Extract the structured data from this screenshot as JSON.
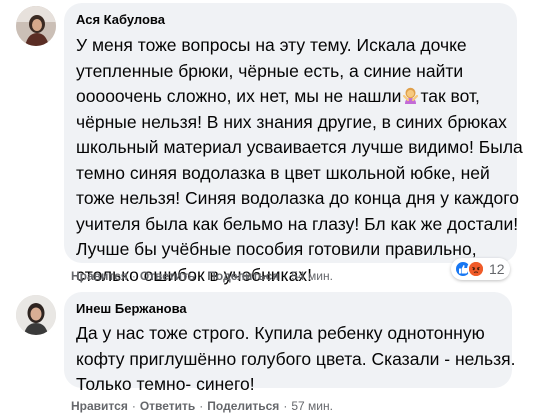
{
  "comments": [
    {
      "author": "Ася Кабулова",
      "text_lines": [
        "У меня тоже вопросы на эту тему. Искала дочке",
        "утепленные брюки, чёрные есть, а синие найти",
        "ооооочень сложно, их нет, мы не нашли",
        "так вот,",
        "чёрные нельзя! В них знания другие, в синих брюках",
        "школьный материал усваивается лучше видимо! Была",
        "темно синяя водолазка в цвет школьной юбке, ней",
        "тоже нельзя! Синяя водолазка до конца дня у каждого",
        "учителя была как бельмо на глазу! Бл как же достали!",
        "Лучше бы учёбные пособия готовили правильно,",
        "столько ошибок в учебниках!"
      ],
      "inline_emoji": "woman-gesturing-no-emoji",
      "actions": {
        "like": "Нравится",
        "reply": "Ответить",
        "share": "Поделиться",
        "time": "54 мин."
      },
      "reactions": {
        "icons": [
          "like-reaction-icon",
          "angry-reaction-icon"
        ],
        "count": "12"
      }
    },
    {
      "author": "Инеш Бержанова",
      "text_lines": [
        "Да у нас тоже строго. Купила ребенку однотонную",
        "кофту приглушённо голубого цвета. Сказали - нельзя.",
        "Только темно- синего!"
      ],
      "actions": {
        "like": "Нравится",
        "reply": "Ответить",
        "share": "Поделиться",
        "time": "57 мин."
      }
    }
  ],
  "separator": "·",
  "colors": {
    "bubble": "#f0f2f5",
    "text": "#050505",
    "meta": "#65676b",
    "like_blue": "#1877f2",
    "angry_orange": "#e9710f"
  }
}
